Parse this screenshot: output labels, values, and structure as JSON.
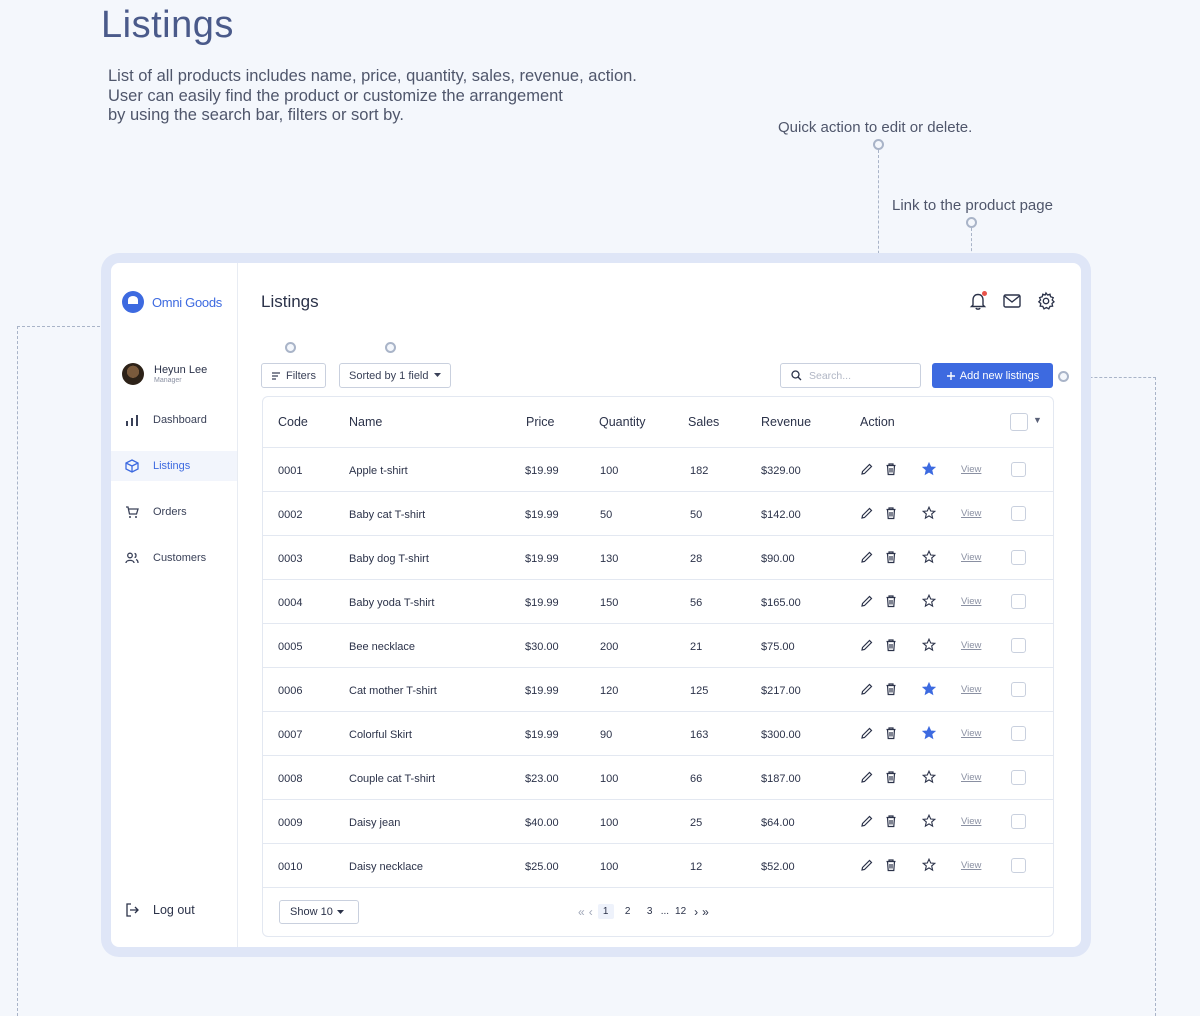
{
  "page": {
    "title": "Listings",
    "description": [
      "List of all products includes name, price, quantity, sales, revenue, action.",
      "User can easily find the product or customize the arrangement",
      "by using the search bar, filters or sort by."
    ],
    "annotations": {
      "quick_action": "Quick action to edit or delete.",
      "product_link": "Link to the product page"
    }
  },
  "app": {
    "brand": "Omni Goods",
    "user": {
      "name": "Heyun Lee",
      "role": "Manager"
    },
    "nav": [
      {
        "label": "Dashboard",
        "icon": "bar-chart-icon",
        "active": false
      },
      {
        "label": "Listings",
        "icon": "box-icon",
        "active": true
      },
      {
        "label": "Orders",
        "icon": "cart-icon",
        "active": false
      },
      {
        "label": "Customers",
        "icon": "users-icon",
        "active": false
      }
    ],
    "logout": "Log out",
    "main_title": "Listings",
    "toolbar": {
      "filters": "Filters",
      "sort": "Sorted by 1 field",
      "search_placeholder": "Search...",
      "add": "Add new listings"
    },
    "table": {
      "columns": [
        "Code",
        "Name",
        "Price",
        "Quantity",
        "Sales",
        "Revenue",
        "Action"
      ],
      "view_label": "View",
      "rows": [
        {
          "code": "0001",
          "name": "Apple t-shirt",
          "price": "$19.99",
          "quantity": "100",
          "sales": "182",
          "revenue": "$329.00",
          "starred": true
        },
        {
          "code": "0002",
          "name": "Baby cat T-shirt",
          "price": "$19.99",
          "quantity": "50",
          "sales": "50",
          "revenue": "$142.00",
          "starred": false
        },
        {
          "code": "0003",
          "name": "Baby dog T-shirt",
          "price": "$19.99",
          "quantity": "130",
          "sales": "28",
          "revenue": "$90.00",
          "starred": false
        },
        {
          "code": "0004",
          "name": "Baby yoda T-shirt",
          "price": "$19.99",
          "quantity": "150",
          "sales": "56",
          "revenue": "$165.00",
          "starred": false
        },
        {
          "code": "0005",
          "name": "Bee necklace",
          "price": "$30.00",
          "quantity": "200",
          "sales": "21",
          "revenue": "$75.00",
          "starred": false
        },
        {
          "code": "0006",
          "name": "Cat mother T-shirt",
          "price": "$19.99",
          "quantity": "120",
          "sales": "125",
          "revenue": "$217.00",
          "starred": true
        },
        {
          "code": "0007",
          "name": "Colorful Skirt",
          "price": "$19.99",
          "quantity": "90",
          "sales": "163",
          "revenue": "$300.00",
          "starred": true
        },
        {
          "code": "0008",
          "name": "Couple cat T-shirt",
          "price": "$23.00",
          "quantity": "100",
          "sales": "66",
          "revenue": "$187.00",
          "starred": false
        },
        {
          "code": "0009",
          "name": "Daisy jean",
          "price": "$40.00",
          "quantity": "100",
          "sales": "25",
          "revenue": "$64.00",
          "starred": false
        },
        {
          "code": "0010",
          "name": "Daisy necklace",
          "price": "$25.00",
          "quantity": "100",
          "sales": "12",
          "revenue": "$52.00",
          "starred": false
        }
      ]
    },
    "footer": {
      "show": "Show 10",
      "pages": [
        "1",
        "2",
        "3",
        "...",
        "12"
      ],
      "current_page": "1"
    },
    "colors": {
      "accent": "#3d6ae0",
      "text": "#2b3249",
      "border": "#e3e8f1"
    }
  }
}
